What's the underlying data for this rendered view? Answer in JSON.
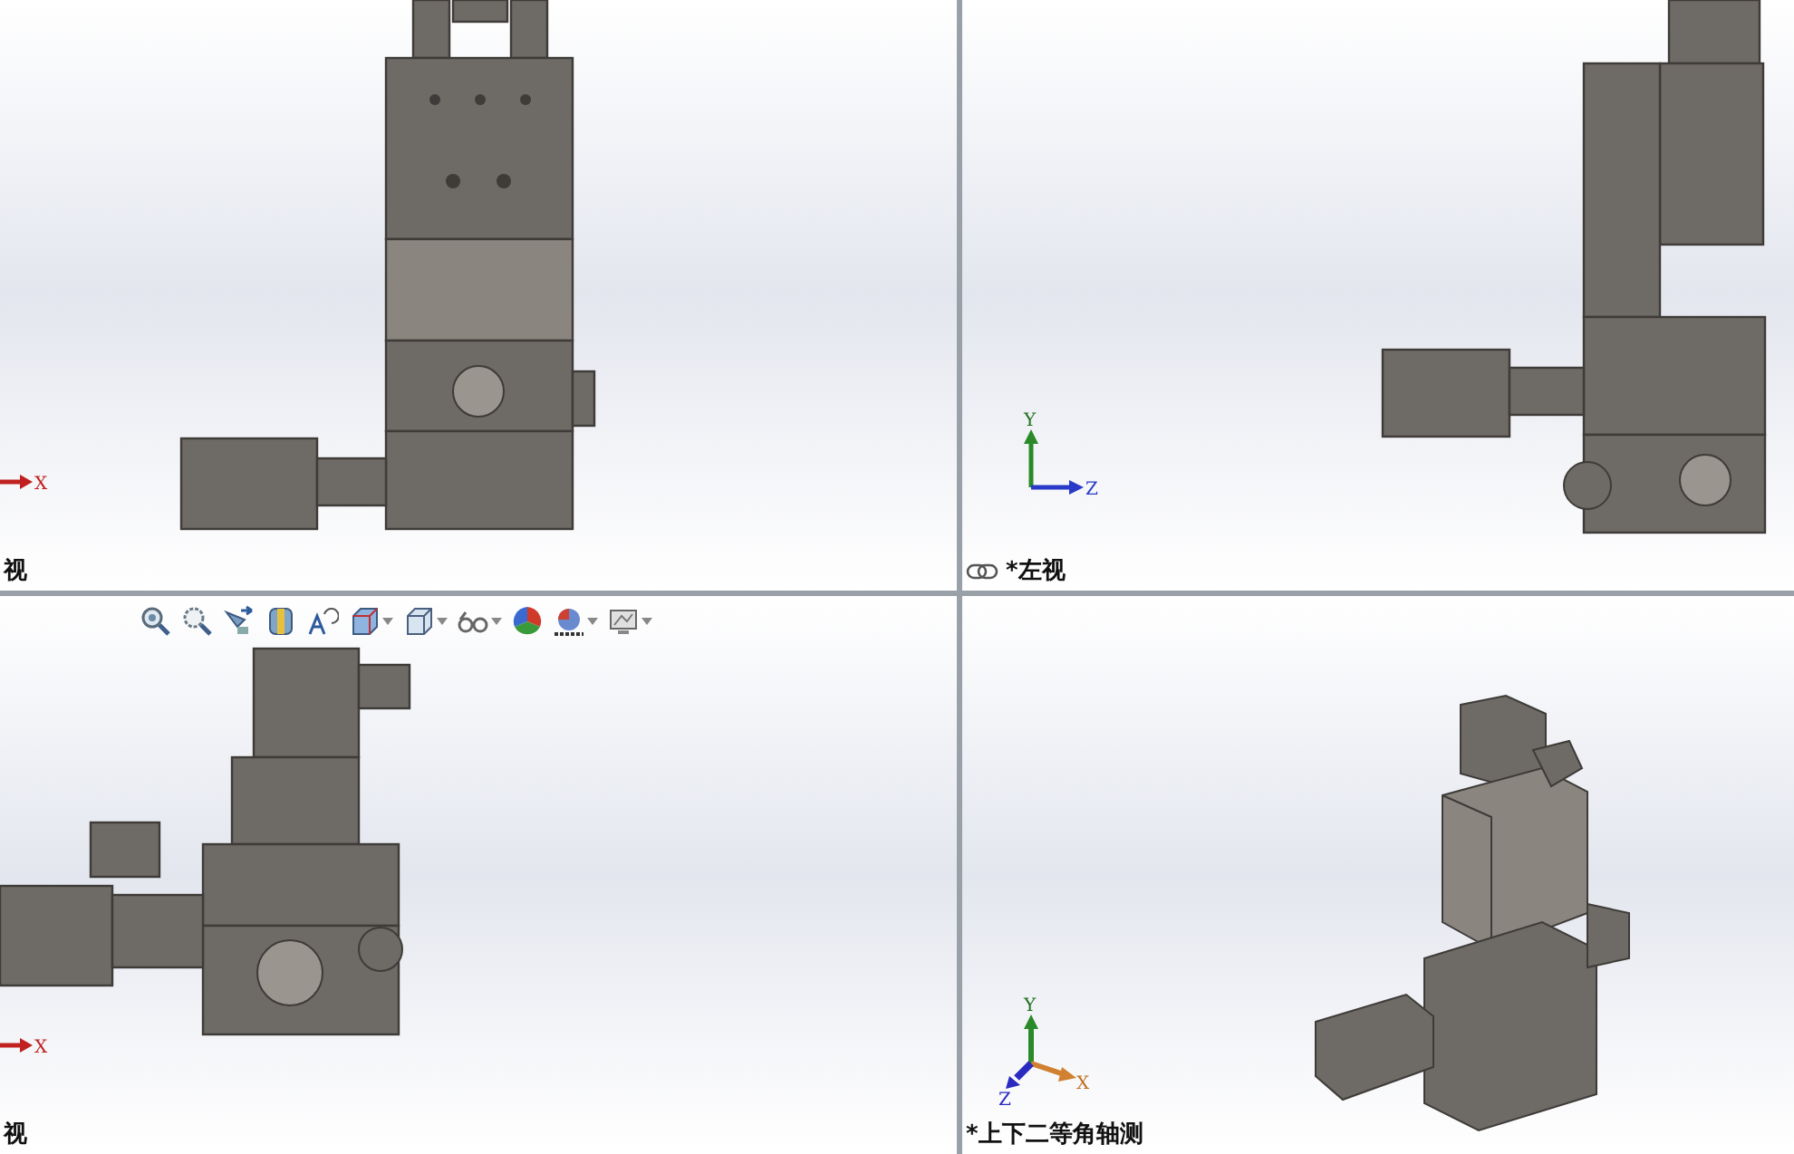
{
  "viewports": [
    {
      "kind": "front",
      "label": "视",
      "triad": {
        "kind": "x-only",
        "axes": {
          "x": "X"
        }
      }
    },
    {
      "kind": "left",
      "label": "*左视",
      "linked": true,
      "triad": {
        "kind": "yz",
        "axes": {
          "y": "Y",
          "z": "Z"
        }
      }
    },
    {
      "kind": "top",
      "label": "视",
      "triad": {
        "kind": "x-only",
        "axes": {
          "x": "X"
        }
      },
      "toolbar": [
        {
          "kind": "zoom-fit",
          "dropdown": false
        },
        {
          "kind": "zoom-area",
          "dropdown": false
        },
        {
          "kind": "previous-view",
          "dropdown": false
        },
        {
          "kind": "section",
          "dropdown": false
        },
        {
          "kind": "dynamic",
          "dropdown": false
        },
        {
          "kind": "view-orientation",
          "dropdown": true
        },
        {
          "kind": "display-style",
          "dropdown": true
        },
        {
          "kind": "hide-show",
          "dropdown": true
        },
        {
          "kind": "appearance",
          "dropdown": false
        },
        {
          "kind": "scene",
          "dropdown": true
        },
        {
          "kind": "view-settings",
          "dropdown": true
        }
      ]
    },
    {
      "kind": "iso",
      "label": "*上下二等角轴测",
      "triad": {
        "kind": "xyz",
        "axes": {
          "x": "X",
          "y": "Y",
          "z": "Z"
        }
      }
    }
  ]
}
